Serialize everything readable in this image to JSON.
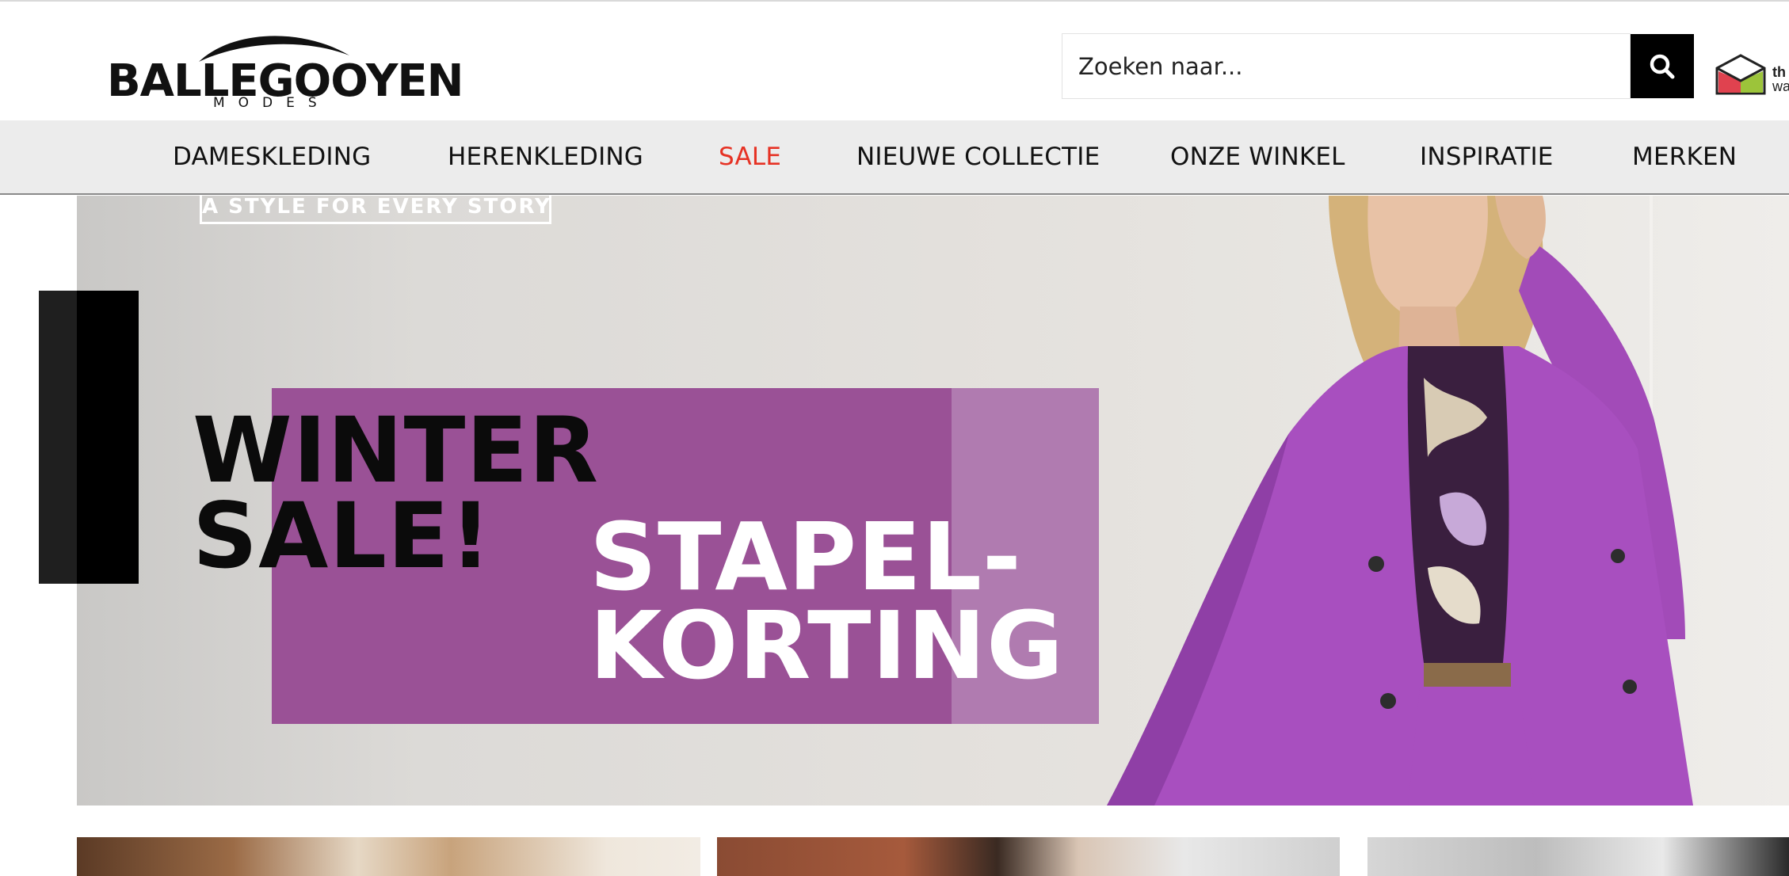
{
  "header": {
    "logo": {
      "name": "BALLEGOOYEN",
      "sub": "MODES"
    },
    "search": {
      "placeholder": "Zoeken naar..."
    },
    "partner_badge": {
      "line1": "th",
      "line2": "wa"
    }
  },
  "nav": {
    "items": [
      {
        "label": "DAMESKLEDING"
      },
      {
        "label": "HERENKLEDING"
      },
      {
        "label": "SALE"
      },
      {
        "label": "NIEUWE COLLECTIE"
      },
      {
        "label": "ONZE WINKEL"
      },
      {
        "label": "INSPIRATIE"
      },
      {
        "label": "MERKEN"
      }
    ]
  },
  "hero": {
    "tagline": "A STYLE FOR EVERY STORY",
    "headline": "WINTER\nSALE!",
    "promo": "STAPEL-\nKORTING"
  },
  "colors": {
    "sale_red": "#e63224",
    "promo_purple": "#9a5196",
    "nav_bg": "#ececec"
  },
  "icons": {
    "search": "search-icon",
    "partner": "house-logo-icon",
    "slider_prev": "slider-prev-handle"
  }
}
